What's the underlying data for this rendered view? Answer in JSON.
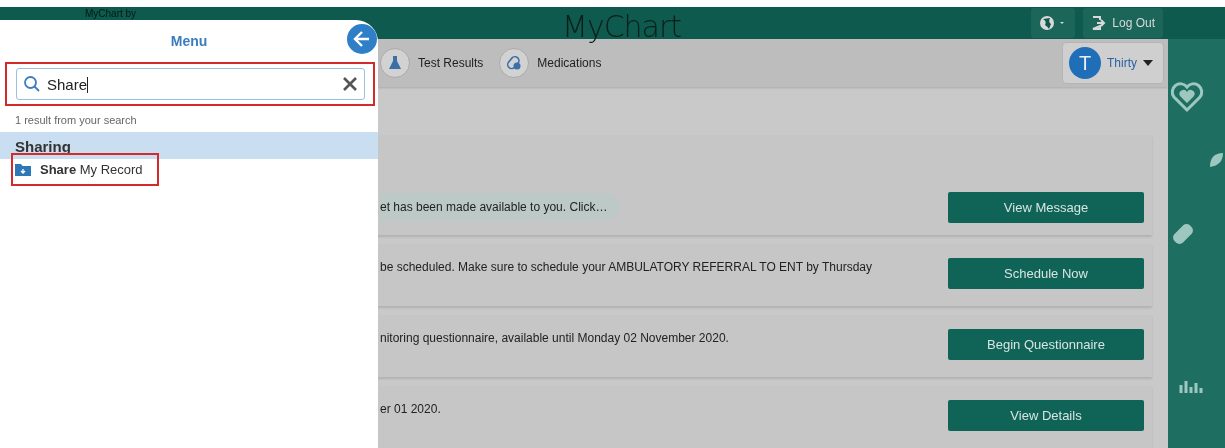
{
  "header": {
    "brand_caption": "MyChart by",
    "logo": "MyChart",
    "logout": "Log Out"
  },
  "nav": {
    "items": [
      {
        "label": "Test Results",
        "kind": "flask"
      },
      {
        "label": "Medications",
        "kind": "pills"
      }
    ],
    "account": {
      "initial": "T",
      "name": "Thirty"
    }
  },
  "cards": [
    {
      "kind": "bubble",
      "text": "et has been made available to you. Click…",
      "button": "View Message"
    },
    {
      "kind": "plain",
      "text": "be scheduled. Make sure to schedule your AMBULATORY REFERRAL TO ENT by Thursday",
      "button": "Schedule Now"
    },
    {
      "kind": "plain",
      "text": "nitoring questionnaire, available until Monday 02 November 2020.",
      "button": "Begin Questionnaire"
    },
    {
      "kind": "plain",
      "text": "er 01 2020.",
      "button": "View Details"
    }
  ],
  "menu": {
    "title": "Menu",
    "search": {
      "value": "Share",
      "highlighted": true
    },
    "result_count": "1 result from your search",
    "groups": [
      {
        "heading": "Sharing",
        "items": [
          {
            "label": "**Share** My Record",
            "highlighted": true
          }
        ]
      }
    ]
  }
}
